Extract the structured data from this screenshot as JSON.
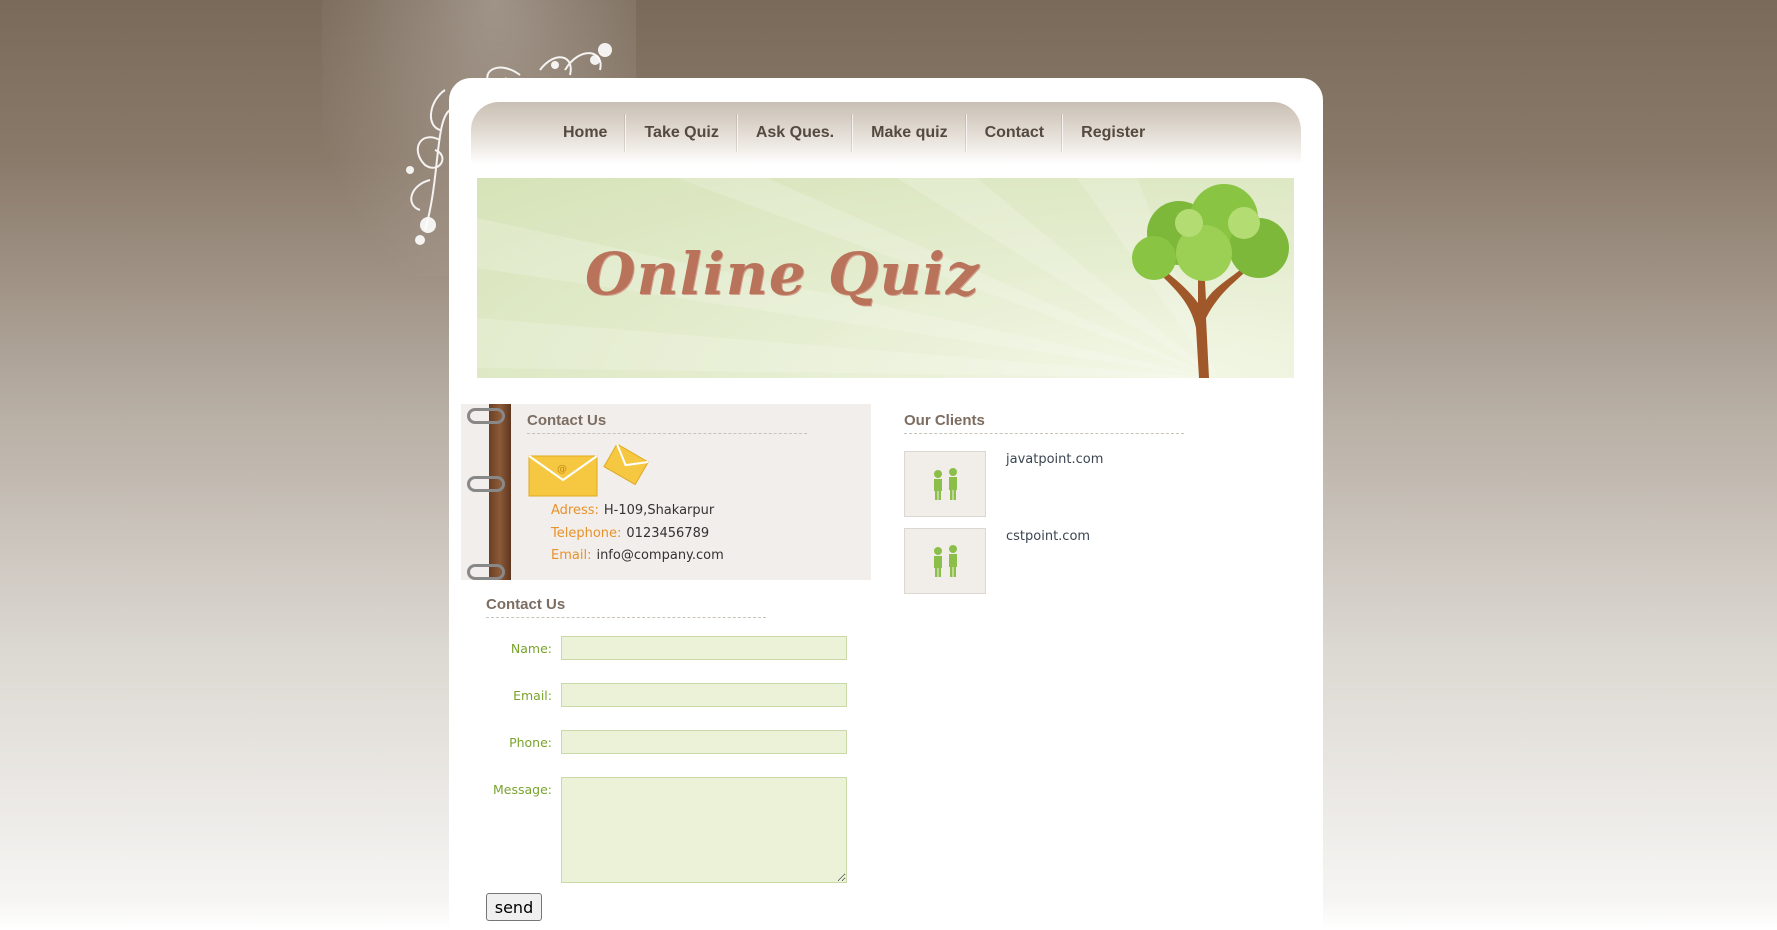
{
  "nav": {
    "items": [
      {
        "label": "Home"
      },
      {
        "label": "Take Quiz"
      },
      {
        "label": "Ask Ques."
      },
      {
        "label": "Make quiz"
      },
      {
        "label": "Contact"
      },
      {
        "label": "Register"
      }
    ]
  },
  "banner": {
    "title": "Online Quiz"
  },
  "contact_info": {
    "heading": "Contact Us",
    "address_label": "Adress:",
    "address": "H-109,Shakarpur",
    "telephone_label": "Telephone:",
    "telephone": "0123456789",
    "email_label": "Email:",
    "email": "info@company.com"
  },
  "contact_form": {
    "heading": "Contact Us",
    "name_label": "Name:",
    "email_label": "Email:",
    "phone_label": "Phone:",
    "message_label": "Message:",
    "send_label": "send"
  },
  "clients": {
    "heading": "Our Clients",
    "items": [
      {
        "name": "javatpoint.com"
      },
      {
        "name": "cstpoint.com"
      }
    ]
  },
  "colors": {
    "label_orange": "#e8922a",
    "form_green": "#7aa32e",
    "input_bg": "#ebf2d8",
    "nav_text": "#554a40"
  }
}
